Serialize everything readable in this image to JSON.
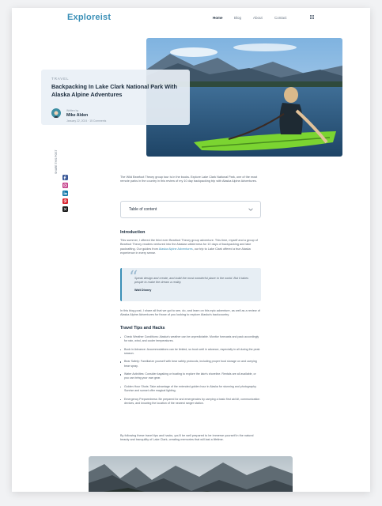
{
  "header": {
    "logo": "Exploreist",
    "nav": [
      "Home",
      "Blog",
      "About",
      "Contact"
    ],
    "active": "Home",
    "menu_icon": "grid-icon"
  },
  "hero": {
    "eyebrow": "TRAVEL",
    "title": "Backpacking In Lake Clark National Park With Alaska Alpine Adventures",
    "written_by": "Written by",
    "author": "Mike Alden",
    "meta": "January 22, 2024 · 15 Comments"
  },
  "share": {
    "label": "SHARE THIS POST",
    "icons": [
      {
        "name": "facebook-icon",
        "color": "#3b5998"
      },
      {
        "name": "instagram-icon",
        "color": "#c13584"
      },
      {
        "name": "linkedin-icon",
        "color": "#0e76a8"
      },
      {
        "name": "pinterest-icon",
        "color": "#d9232e"
      },
      {
        "name": "x-icon",
        "color": "#1a1a1a"
      }
    ]
  },
  "article": {
    "intro": "The Wild Bearfoot Theory group tour is in the books. Explore Lake Clark National Park, one of the most remote parks in the country in this review of my 10 day backpacking trip with Alaska Alpine Adventures.",
    "toc_label": "Table of content",
    "intro_heading": "Introduction",
    "intro_body_1": "This summer, I offered the third ever Bearfoot Theory group adventure. This time, myself and a group of Bearfoot Theory readers ventured into the Alaskan wilderness for 10 days of backpacking and lake packrafting. Our guides from ",
    "intro_link": "Alaska Alpine Adventures",
    "intro_body_2": ", our trip to Lake Clark offered a true Alaska experience in every sense.",
    "quote": "Speak design and create, and build the most wonderful place in the world. But it takes people to make the dream a reality.",
    "quote_author": "Walt Disney",
    "post_quote": "In this blog post, I share all that we got to see, do, and learn on this epic adventure, as well as a review of Alaska Alpine Adventures for those of you looking to explore Alaska's backcountry.",
    "tips_heading": "Travel Tips and Hacks",
    "tips": [
      "Check Weather Conditions: Alaska's weather can be unpredictable. Monitor forecasts and pack accordingly for rain, wind, and cooler temperatures.",
      "Book in Advance: Accommodations can be limited, so book well in advance, especially in all during the peak season.",
      "Bear Safety: Familiarize yourself with bear safety protocols, including proper food storage on and carrying bear spray.",
      "Water Activities: Consider kayaking or boating to explore the lake's shoreline. Rentals are all available, or you can bring your own gear.",
      "Golden Hour Shots: Take advantage of the extended golden hour in Alaska for stunning and photography. Sunrise and sunset offer magical lighting.",
      "Emergency Preparedness: Be prepared for and emergencies by carrying a basic first aid kit, communication devices, and knowing the location of the nearest ranger station."
    ],
    "closing": "By following these travel tips and hacks, you'll be well prepared to be immerse yourself in the natural beauty and tranquility of Lake Clark, creating memories that will last a lifetime."
  }
}
